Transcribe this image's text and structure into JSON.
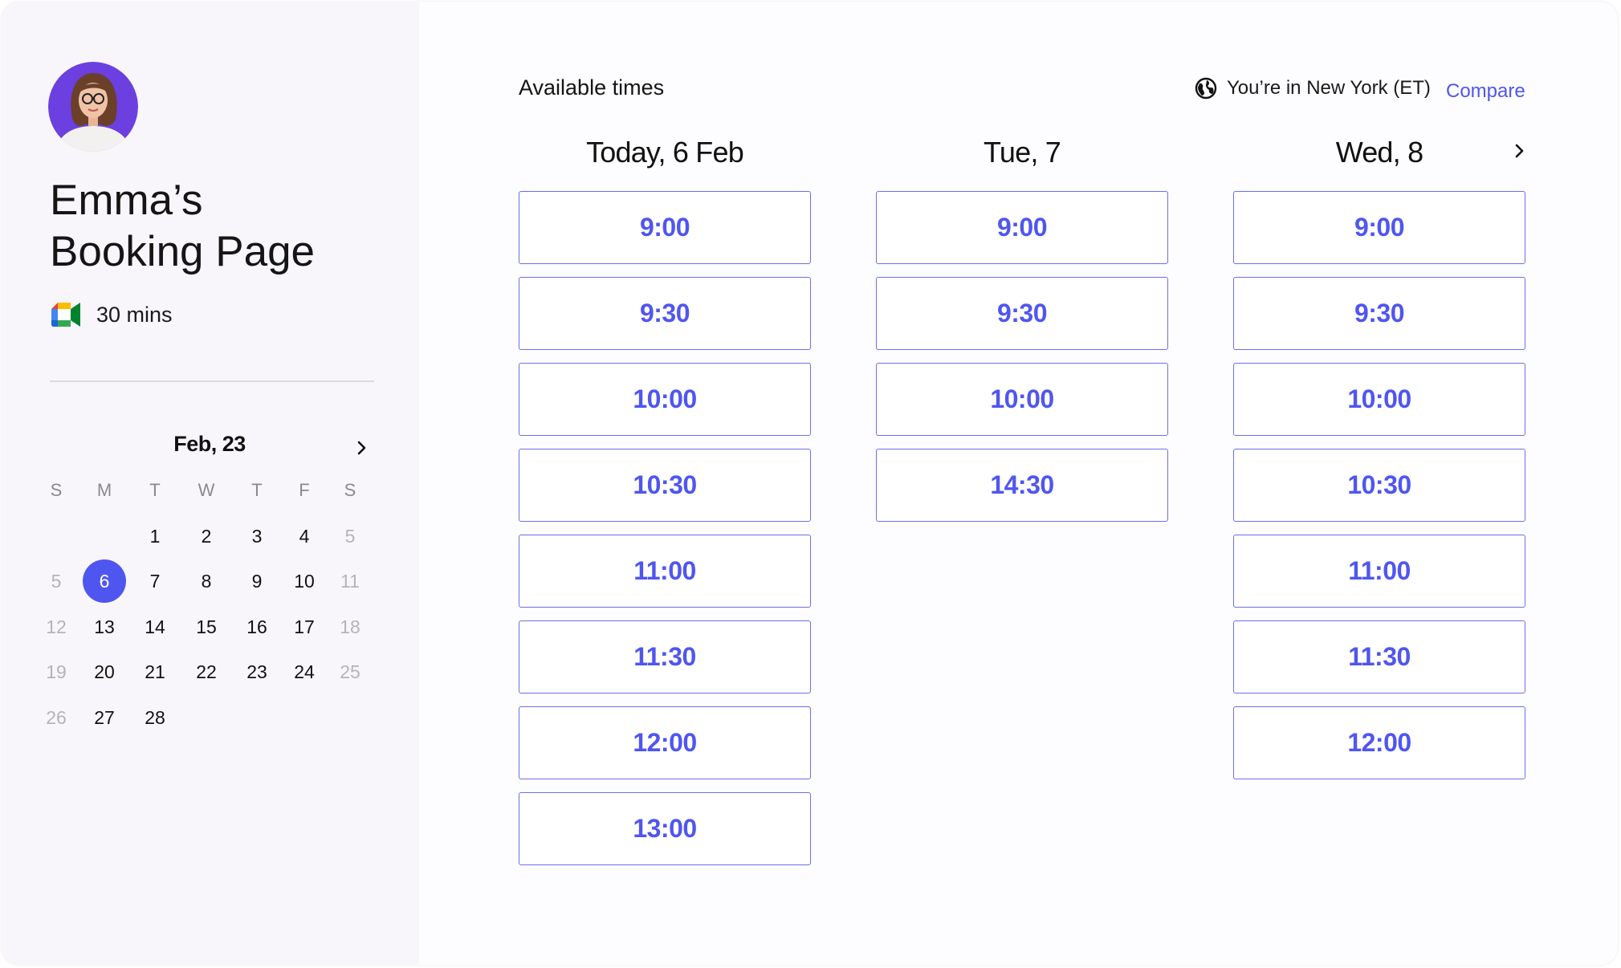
{
  "host": {
    "title": "Emma’s\nBooking Page",
    "duration": "30 mins",
    "meeting_icon": "google-meet-icon",
    "avatar_icon": "avatar-photo"
  },
  "calendar": {
    "month_label": "Feb, 23",
    "next_icon": "chevron-right-icon",
    "weekdays": [
      "S",
      "M",
      "T",
      "W",
      "T",
      "F",
      "S"
    ],
    "weeks": [
      [
        "",
        "",
        "1",
        "2",
        "3",
        "4",
        "5"
      ],
      [
        "5",
        "6",
        "7",
        "8",
        "9",
        "10",
        "11"
      ],
      [
        "12",
        "13",
        "14",
        "15",
        "16",
        "17",
        "18"
      ],
      [
        "19",
        "20",
        "21",
        "22",
        "23",
        "24",
        "25"
      ],
      [
        "26",
        "27",
        "28",
        "",
        "",
        "",
        ""
      ]
    ],
    "selected_day": "6"
  },
  "availability": {
    "title": "Available times",
    "timezone_label": "You’re in New York (ET)",
    "timezone_icon": "globe-icon",
    "compare_label": "Compare",
    "next_icon": "chevron-right-icon",
    "days": [
      {
        "label": "Today, 6 Feb",
        "slots": [
          "9:00",
          "9:30",
          "10:00",
          "10:30",
          "11:00",
          "11:30",
          "12:00",
          "13:00"
        ]
      },
      {
        "label": "Tue, 7",
        "slots": [
          "9:00",
          "9:30",
          "10:00",
          "14:30"
        ]
      },
      {
        "label": "Wed, 8",
        "slots": [
          "9:00",
          "9:30",
          "10:00",
          "10:30",
          "11:00",
          "11:30",
          "12:00"
        ]
      }
    ]
  },
  "colors": {
    "accent": "#4f56f0",
    "slot_border": "#6b70ee",
    "sidebar_bg": "#f8f6fa",
    "avatar_bg": "#6b3fe0"
  }
}
